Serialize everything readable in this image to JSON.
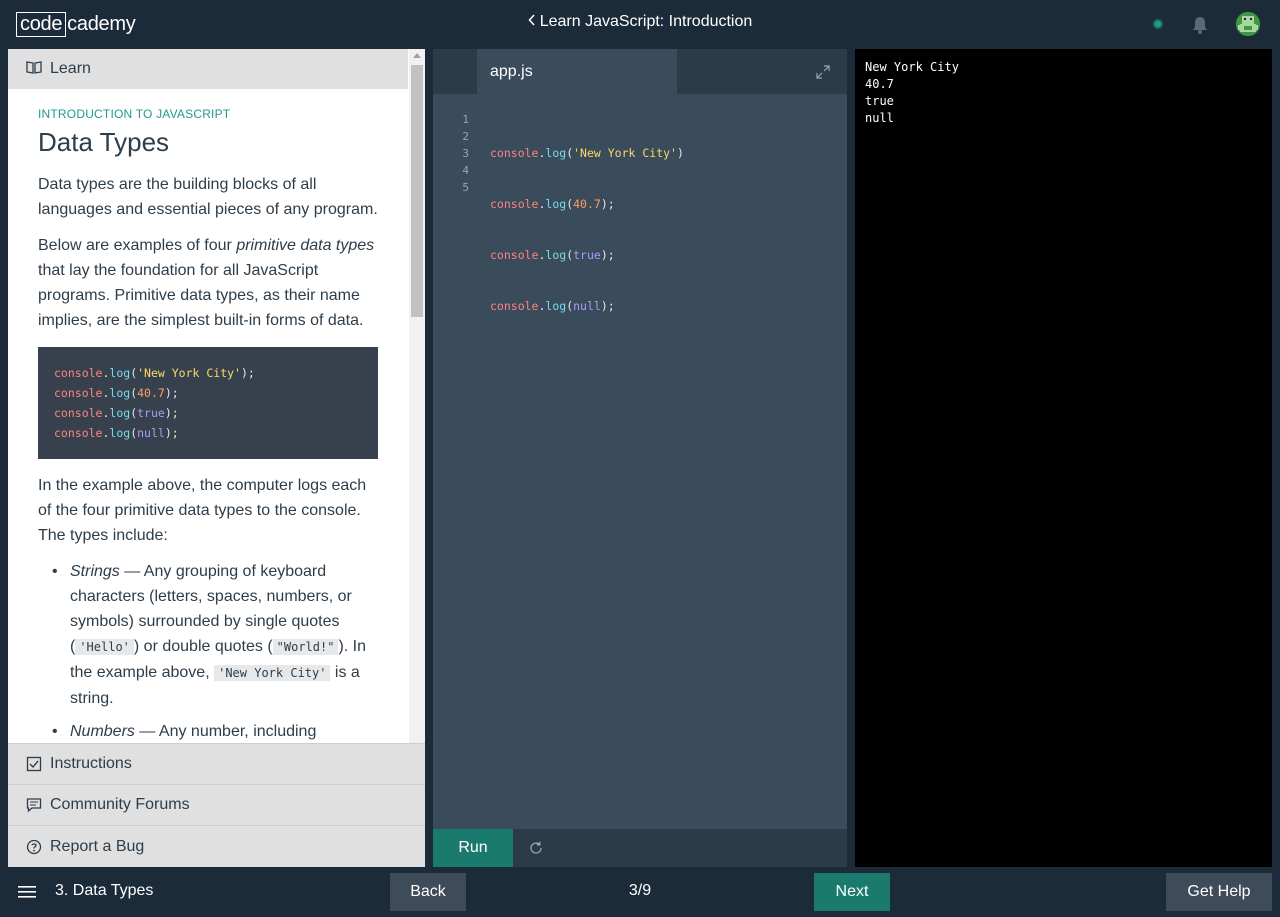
{
  "header": {
    "logo_box": "code",
    "logo_rest": "cademy",
    "course_title": "Learn JavaScript: Introduction"
  },
  "learn_panel": {
    "header_label": "Learn",
    "kicker": "INTRODUCTION TO JAVASCRIPT",
    "title": "Data Types",
    "para1": "Data types are the building blocks of all languages and essential pieces of any program.",
    "para2_a": "Below are examples of four ",
    "para2_em": "primitive data types",
    "para2_b": " that lay the foundation for all JavaScript programs. Primitive data types, as their name implies, are the simplest built-in forms of data.",
    "para3": "In the example above, the computer logs each of the four primitive data types to the console. The types include:",
    "bullet1": {
      "term": "Strings",
      "t1": " — Any grouping of keyboard characters (letters, spaces, numbers, or symbols) surrounded by single quotes (",
      "c1": "'Hello'",
      "t2": ") or double quotes (",
      "c2": "\"World!\"",
      "t3": "). In the example above, ",
      "c3": "'New York City'",
      "t4": " is a string."
    },
    "bullet2": {
      "term": "Numbers",
      "t1": " — Any number, including"
    }
  },
  "code": {
    "obj": "console",
    "dot": ".",
    "fn": "log",
    "open": "(",
    "close_semi": ");",
    "close": ")",
    "v1": "'New York City'",
    "v2": "40.7",
    "v3": "true",
    "v4": "null"
  },
  "panel_tabs": {
    "instructions": "Instructions",
    "forums": "Community Forums",
    "bug": "Report a Bug"
  },
  "editor": {
    "file_name": "app.js",
    "line_numbers": [
      "1",
      "2",
      "3",
      "4",
      "5"
    ],
    "run_label": "Run"
  },
  "output": {
    "lines": [
      "New York City",
      "40.7",
      "true",
      "null"
    ]
  },
  "footer": {
    "lesson_name": "3. Data Types",
    "back_label": "Back",
    "progress": "3/9",
    "next_label": "Next",
    "help_label": "Get Help"
  },
  "colors": {
    "accent": "#1a7a6e",
    "status_dot": "#16a58a",
    "kicker": "#1f9a8f"
  }
}
